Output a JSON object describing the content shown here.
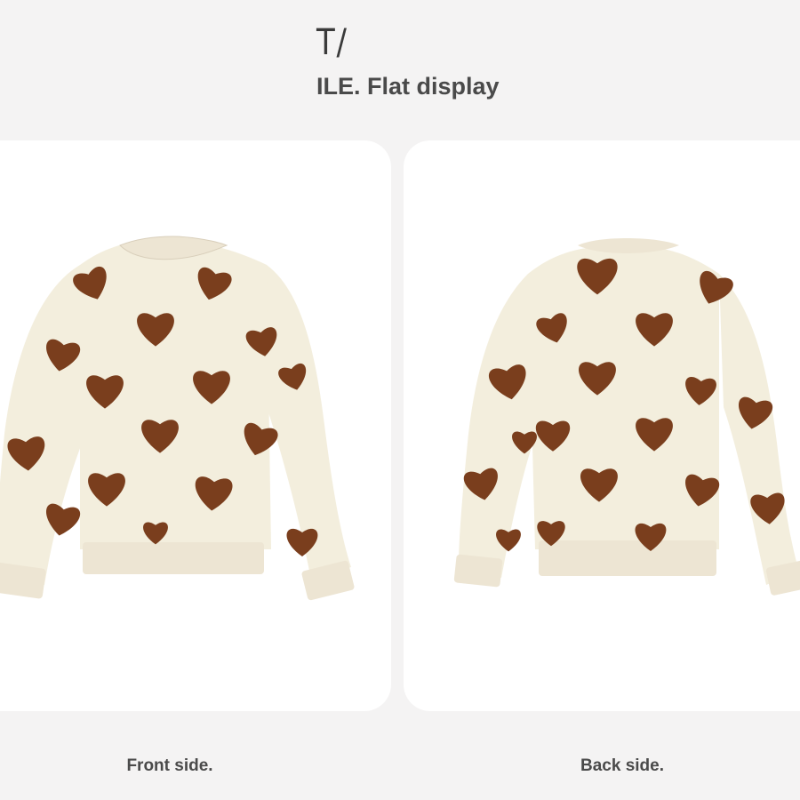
{
  "header": {
    "mark": "T/",
    "subtitle": "ILE. Flat display"
  },
  "captions": {
    "front": "Front side.",
    "back": "Back side."
  },
  "colors": {
    "page_bg": "#f4f3f3",
    "card_bg": "#ffffff",
    "fleece": "#f3eedd",
    "heart": "#7a3e1d",
    "rib": "#ede5d3"
  },
  "images": [
    {
      "name": "sweater-front-image",
      "description_icon": "sweater-front"
    },
    {
      "name": "sweater-back-image",
      "description_icon": "sweater-back"
    }
  ]
}
